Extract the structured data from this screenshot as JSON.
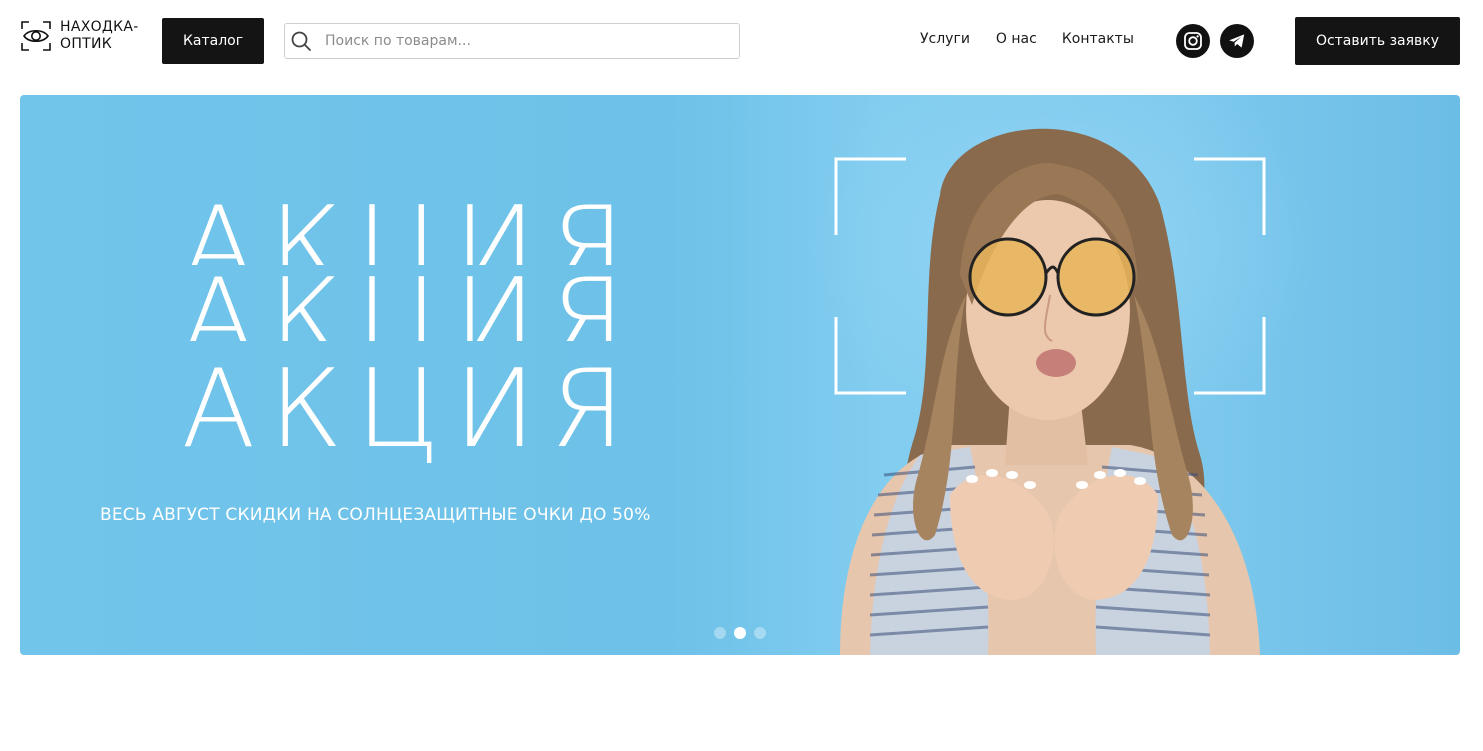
{
  "header": {
    "logo": {
      "line1": "НАХОДКА-",
      "line2": "ОПТИК",
      "icon": "eye-frame-icon"
    },
    "catalog_label": "Каталог",
    "search": {
      "placeholder": "Поиск по товарам...",
      "value": "",
      "icon": "search-icon"
    },
    "nav": [
      {
        "label": "Услуги"
      },
      {
        "label": "О нас"
      },
      {
        "label": "Контакты"
      }
    ],
    "social": [
      {
        "name": "instagram-icon"
      },
      {
        "name": "telegram-icon"
      }
    ],
    "request_label": "Оставить заявку"
  },
  "banner": {
    "title": "АКЦИЯ",
    "subtitle": "ВЕСЬ АВГУСТ СКИДКИ НА СОЛНЦЕЗАЩИТНЫЕ ОЧКИ ДО 50%",
    "background_color": "#71c4ea",
    "slides_total": 3,
    "active_slide": 2
  },
  "colors": {
    "accent": "#141414",
    "text": "#111111",
    "placeholder": "#8c8c8c"
  }
}
